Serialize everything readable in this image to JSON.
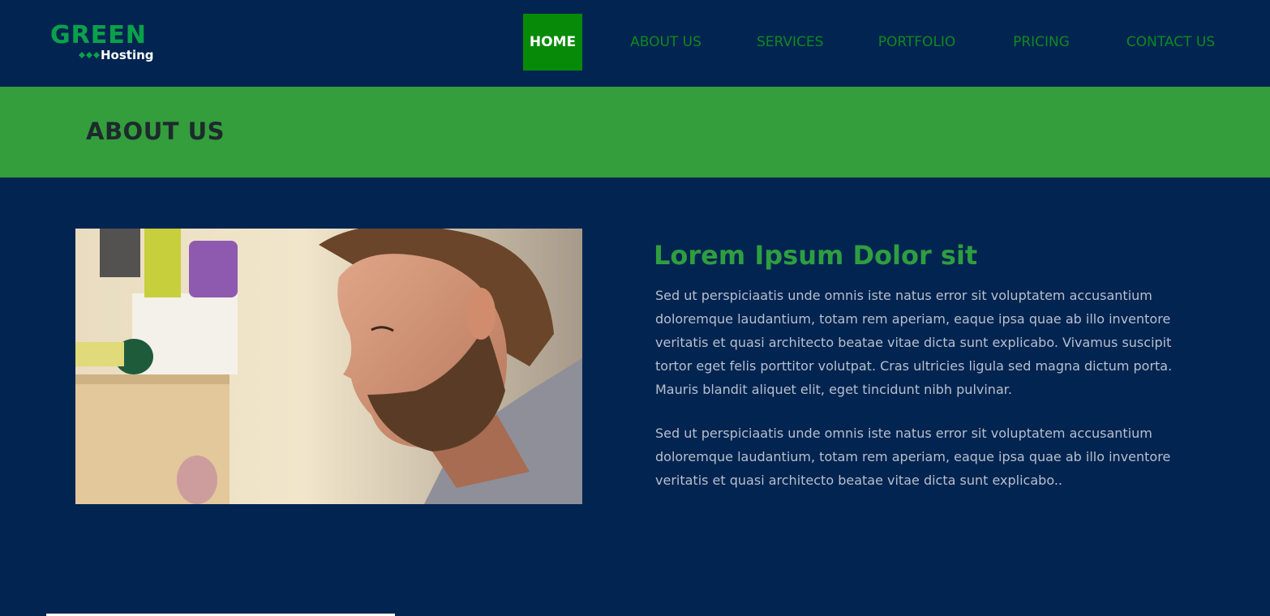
{
  "logo": {
    "main": "GREEN",
    "sub": "Hosting",
    "dots_icon": "diamond-dots-icon"
  },
  "nav": {
    "items": [
      {
        "label": "HOME",
        "active": true
      },
      {
        "label": "ABOUT US",
        "active": false
      },
      {
        "label": "SERVICES",
        "active": false
      },
      {
        "label": "PORTFOLIO",
        "active": false
      },
      {
        "label": "PRICING",
        "active": false
      },
      {
        "label": "CONTACT US",
        "active": false
      }
    ]
  },
  "banner": {
    "title": "ABOUT US"
  },
  "content": {
    "heading": "Lorem Ipsum Dolor sit",
    "paragraphs": [
      "Sed ut perspiciaatis unde omnis iste natus error sit voluptatem accusantium doloremque laudantium, totam rem aperiam, eaque ipsa quae ab illo inventore veritatis et quasi architecto beatae vitae dicta sunt explicabo. Vivamus suscipit tortor eget felis porttitor volutpat. Cras ultricies ligula sed magna dictum porta. Mauris blandit aliquet elit, eget tincidunt nibh pulvinar.",
      "Sed ut perspiciaatis unde omnis iste natus error sit voluptatem accusantium doloremque laudantium, totam rem aperiam, eaque ipsa quae ab illo inventore veritatis et quasi architecto beatae vitae dicta sunt explicabo.."
    ]
  },
  "colors": {
    "background": "#022451",
    "accent_green": "#349d3c",
    "nav_active_bg": "#078a07",
    "nav_text": "#0b8a1f",
    "heading_green": "#2e9e40",
    "body_text": "#b8bfcb"
  }
}
